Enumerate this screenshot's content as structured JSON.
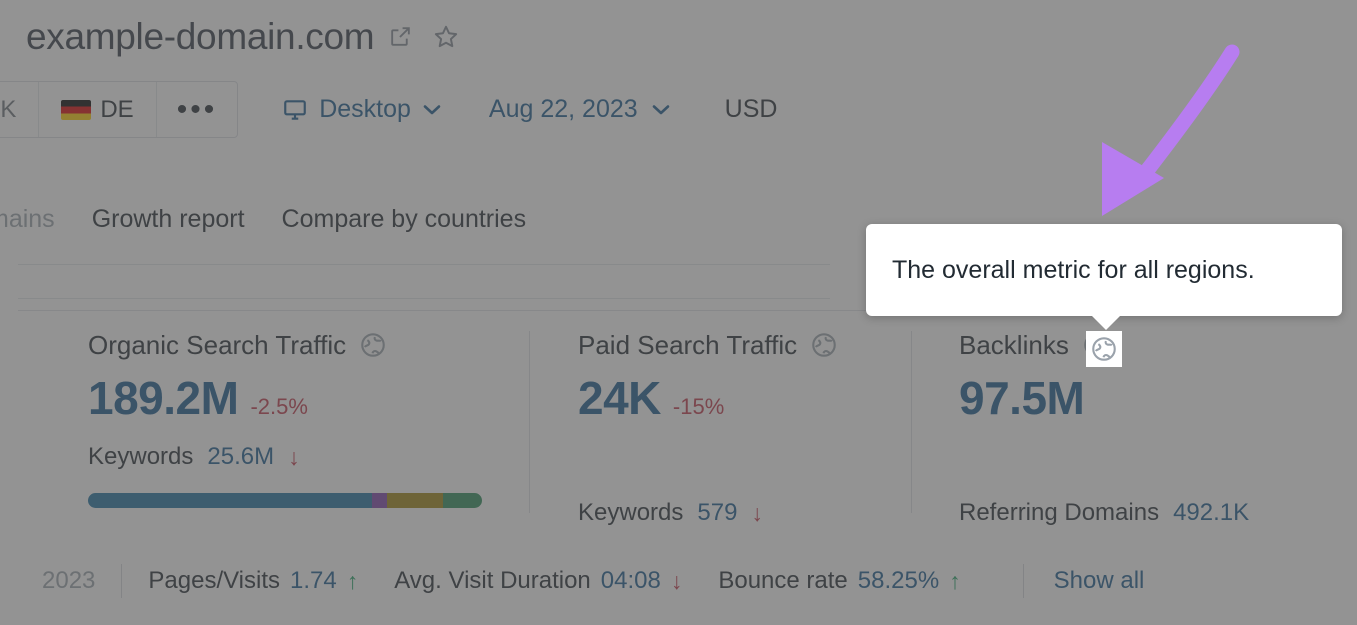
{
  "header": {
    "domain": "example-domain.com",
    "external_link_icon": "external-link-icon",
    "favorite_icon": "star-icon"
  },
  "database_selector": {
    "items": [
      {
        "code": "UK",
        "flag": "uk-flag",
        "active": false
      },
      {
        "code": "DE",
        "flag": "de-flag",
        "active": true
      }
    ],
    "more_label": "•••"
  },
  "device_selector": {
    "label": "Desktop",
    "icon": "monitor-icon",
    "caret": "chevron-down-icon"
  },
  "date_selector": {
    "label": "Aug 22, 2023",
    "caret": "chevron-down-icon"
  },
  "currency": {
    "label": "USD"
  },
  "tabs": [
    {
      "label": "mains",
      "muted": true
    },
    {
      "label": "Growth report",
      "muted": false
    },
    {
      "label": "Compare by countries",
      "muted": false
    }
  ],
  "tooltip": {
    "text": "The overall metric for all regions."
  },
  "annotation": {
    "arrow_color": "#b77df0",
    "arrow_name": "purple-callout-arrow"
  },
  "metrics": [
    {
      "title": "Organic Search Traffic",
      "globe_icon": "globe-icon",
      "value": "189.2M",
      "delta": "-2.5%",
      "delta_direction": "down",
      "sub_label": "Keywords",
      "sub_value": "25.6M",
      "sub_trend": "↓",
      "sub_trend_direction": "down",
      "progress": [
        {
          "name": "organic",
          "percent": 72,
          "color": "#1f72a0"
        },
        {
          "name": "purple-segment",
          "percent": 4,
          "color": "#7b3fa8"
        },
        {
          "name": "gold-segment",
          "percent": 14,
          "color": "#9e8412"
        },
        {
          "name": "green-segment",
          "percent": 10,
          "color": "#2b8c5a"
        }
      ]
    },
    {
      "title": "Paid Search Traffic",
      "globe_icon": "globe-icon",
      "value": "24K",
      "delta": "-15%",
      "delta_direction": "down",
      "sub_label": "Keywords",
      "sub_value": "579",
      "sub_trend": "↓",
      "sub_trend_direction": "down"
    },
    {
      "title": "Backlinks",
      "globe_icon": "globe-icon",
      "value": "97.5M",
      "delta": "",
      "delta_direction": "none",
      "sub_label": "Referring Domains",
      "sub_value": "492.1K",
      "sub_trend": "",
      "sub_trend_direction": "none"
    }
  ],
  "bottom_bar": {
    "year": "2023",
    "items": [
      {
        "label": "Pages/Visits",
        "value": "1.74",
        "trend": "↑",
        "direction": "up"
      },
      {
        "label": "Avg. Visit Duration",
        "value": "04:08",
        "trend": "↓",
        "direction": "down"
      },
      {
        "label": "Bounce rate",
        "value": "58.25%",
        "trend": "↑",
        "direction": "up"
      }
    ],
    "show_all_label": "Show all"
  },
  "colors": {
    "accent_blue": "#1a5b8f",
    "negative_red": "#c1374b",
    "positive_green": "#21a366",
    "text_dark": "#222b33",
    "scrim": "rgba(80,80,80,0.62)"
  }
}
